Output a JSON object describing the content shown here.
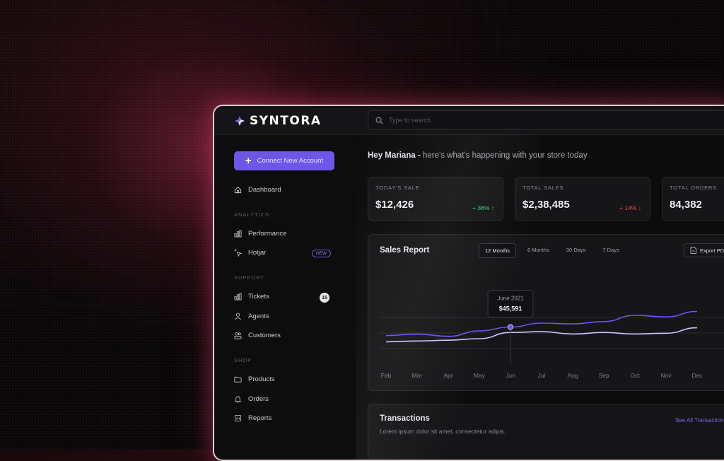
{
  "brand": {
    "name": "SYNTORA"
  },
  "search": {
    "placeholder": "Type to search"
  },
  "sidebar": {
    "connect_label": "Connect New Account",
    "dashboard": "Dashboard",
    "sections": {
      "analytics": "ANALYTICS",
      "support": "SUPPORT",
      "shop": "SHOP"
    },
    "items": {
      "performance": "Performance",
      "hotjar": "Hotjar",
      "hotjar_badge": "NEW",
      "tickets": "Tickets",
      "tickets_count": "15",
      "agents": "Agents",
      "customers": "Customers",
      "products": "Products",
      "orders": "Orders",
      "reports": "Reports"
    }
  },
  "greeting": {
    "name": "Hey Mariana -",
    "message": "here's what's happening with your store today"
  },
  "stats": [
    {
      "label": "TODAY'S SALE",
      "value": "$12,426",
      "change": "+ 36% ↑",
      "trend": "up"
    },
    {
      "label": "TOTAL SALES",
      "value": "$2,38,485",
      "change": "+ 14% ↓",
      "trend": "down"
    },
    {
      "label": "TOTAL ORDERS",
      "value": "84,382"
    }
  ],
  "report": {
    "title": "Sales Report",
    "tabs": [
      "12 Months",
      "6 Months",
      "30 Days",
      "7 Days"
    ],
    "active_tab": "12 Months",
    "export_label": "Export PDF",
    "tooltip": {
      "label": "June 2021",
      "value": "$45,591"
    }
  },
  "chart_data": {
    "type": "line",
    "categories": [
      "Feb",
      "Mar",
      "Apr",
      "May",
      "Jun",
      "Jul",
      "Aug",
      "Sep",
      "Oct",
      "Nov",
      "Dec"
    ],
    "series": [
      {
        "values": [
          34,
          36,
          33,
          40,
          45,
          50,
          49,
          52,
          60,
          58,
          65
        ]
      },
      {
        "values": [
          26,
          27,
          28,
          30,
          38,
          39,
          36,
          38,
          36,
          37,
          44
        ]
      }
    ],
    "ylim": [
      0,
      100
    ],
    "grid": true,
    "colors": [
      "#6a55f0",
      "#c9c4ff"
    ]
  },
  "transactions": {
    "title": "Transactions",
    "subtitle": "Lorem ipsum dolor sit amet, consectetur adipis.",
    "link": "See All Transactions"
  }
}
